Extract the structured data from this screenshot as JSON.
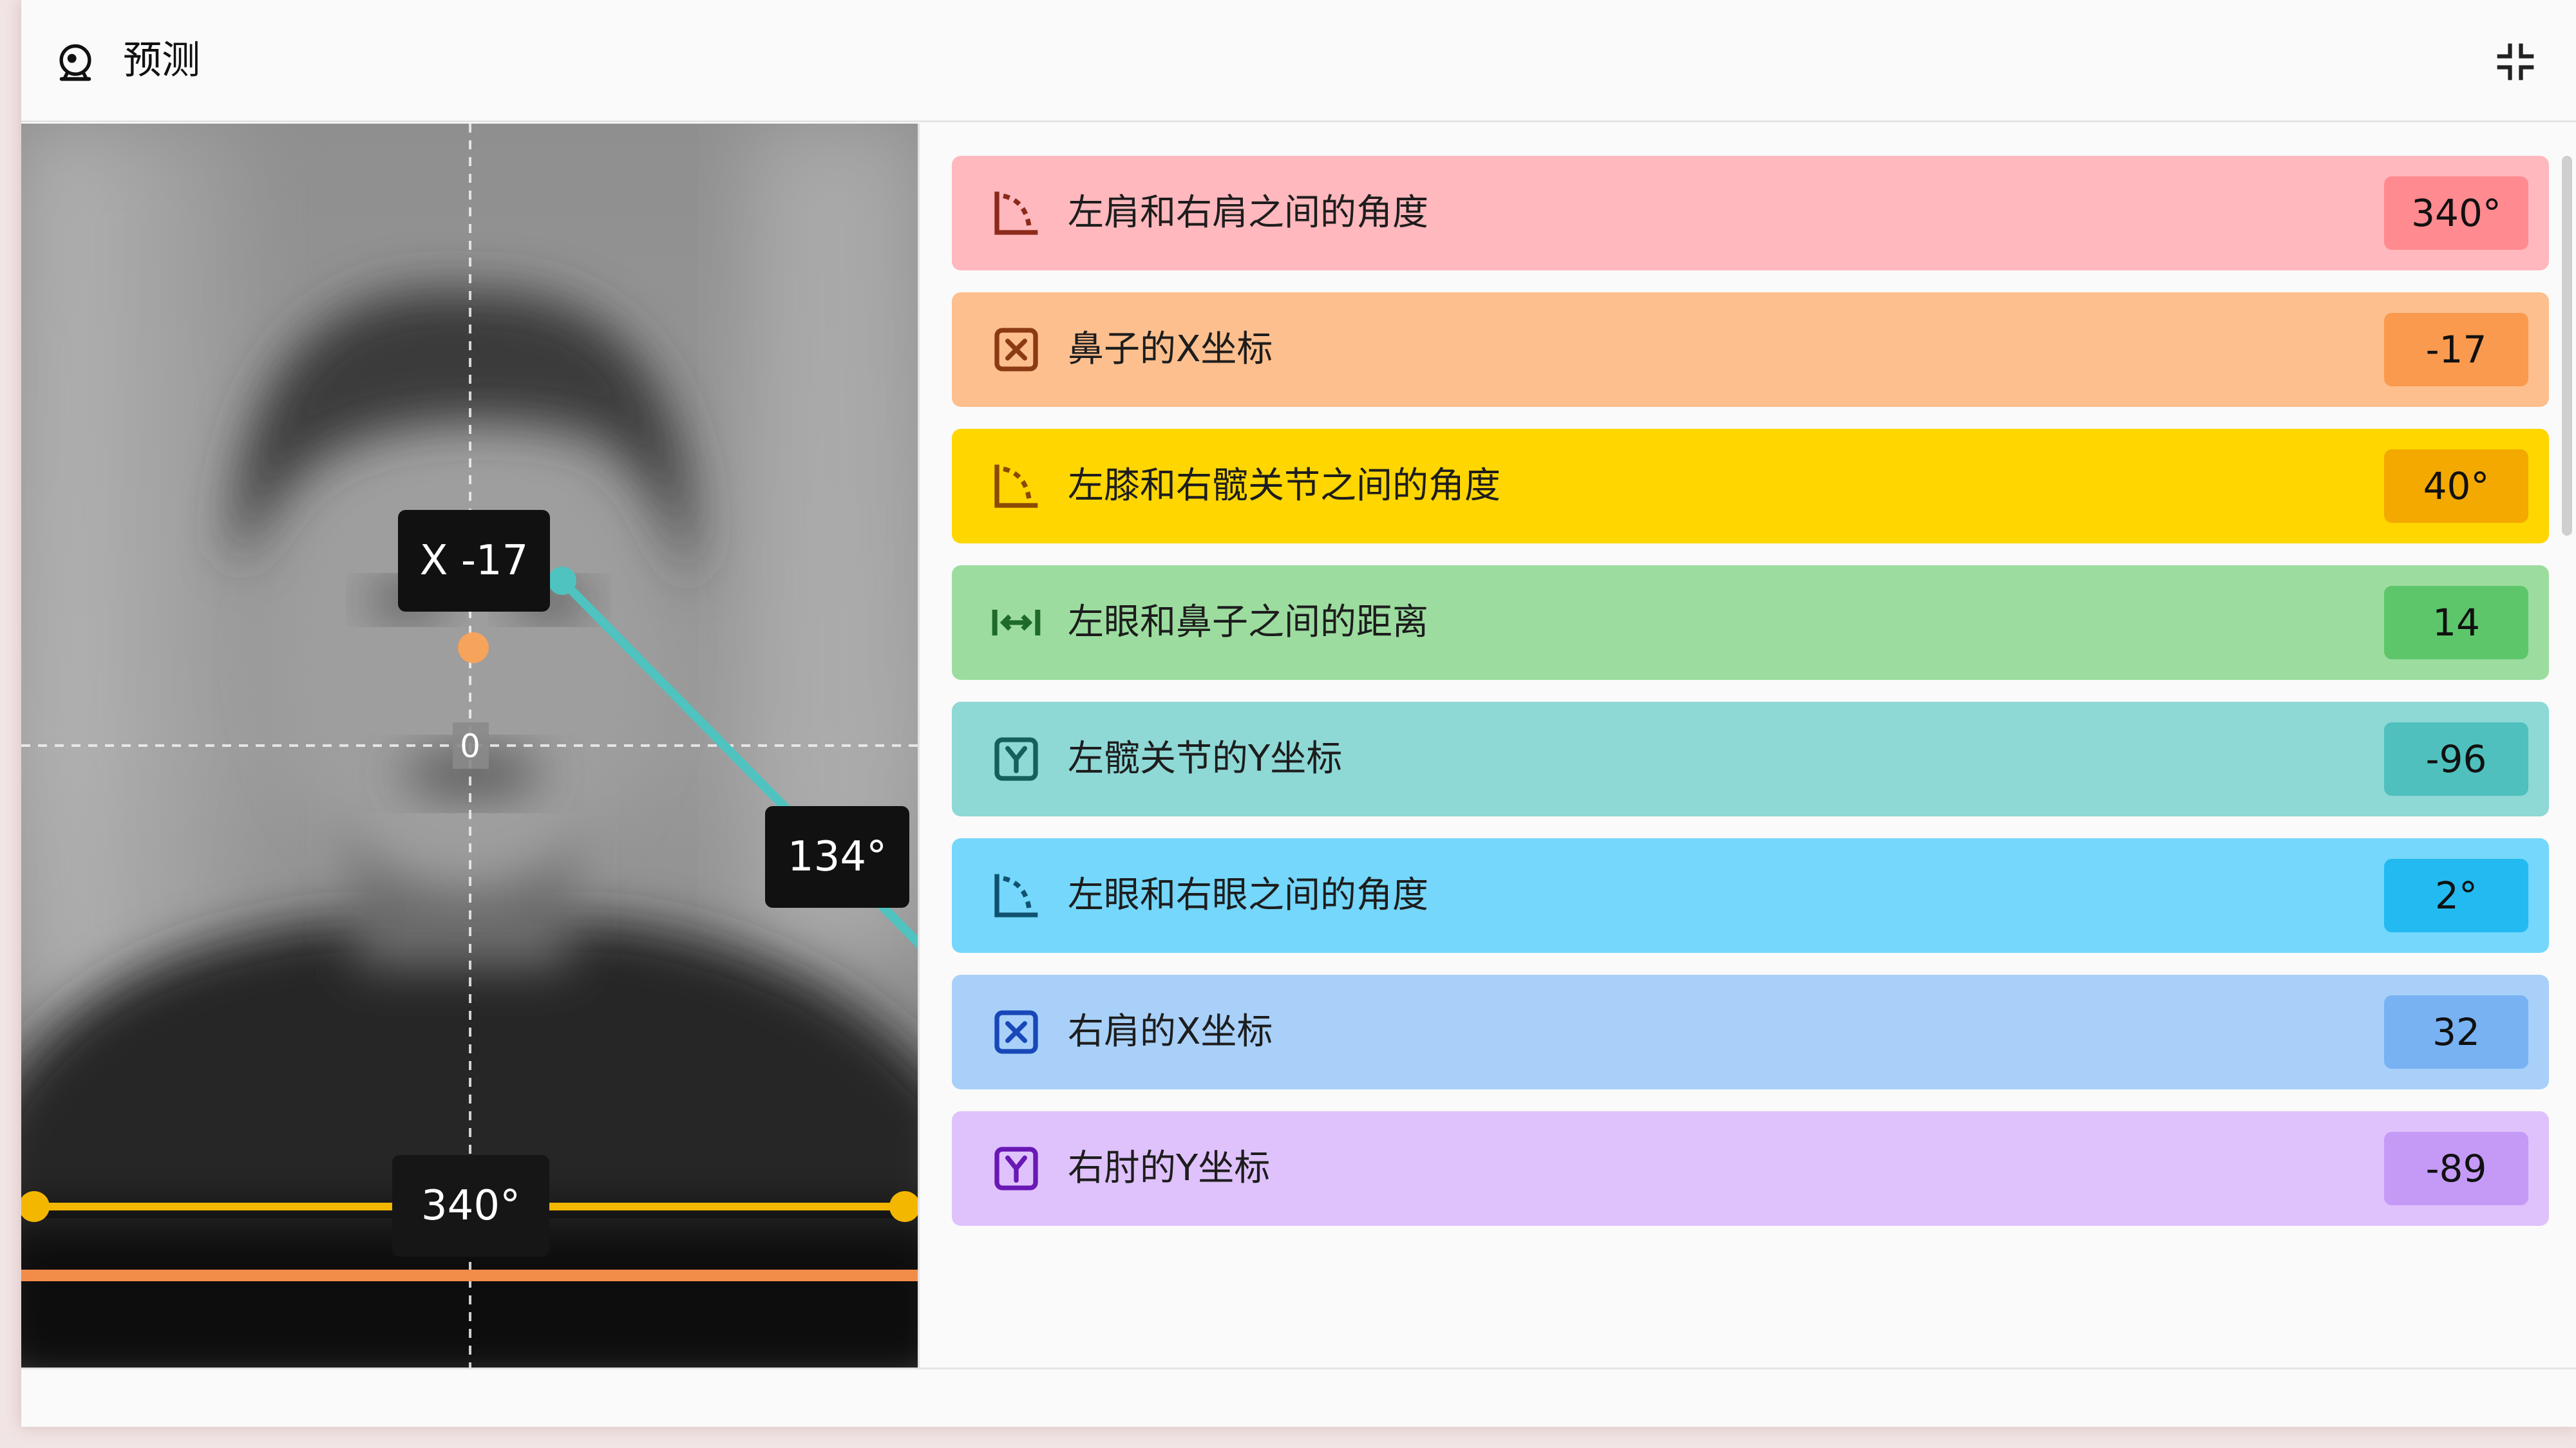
{
  "window": {
    "title": "预测",
    "title_icon": "robot-head-icon",
    "collapse_icon": "collapse-arrows-icon"
  },
  "camera": {
    "image": "blurred grayscale webcam view of a person",
    "axis_origin_label": "0",
    "nose_tag": "X -17",
    "elbow_angle_tag": "134°",
    "shoulder_angle_tag": "340°",
    "colors": {
      "teal_line": "#4fc3c0",
      "orange_point": "#f6a35b",
      "yellow_line": "#f3b700",
      "orange_line": "#f28c49"
    }
  },
  "items": [
    {
      "label": "左肩和右肩之间的角度",
      "value": "340°",
      "icon": "angle-icon",
      "bg": "#ffb8bd",
      "badge": "#ff8a8f",
      "icon_color": "#8b2a1a"
    },
    {
      "label": "鼻子的X坐标",
      "value": "-17",
      "icon": "x-box-icon",
      "bg": "#fdbf8e",
      "badge": "#f99a4e",
      "icon_color": "#8b3a13"
    },
    {
      "label": "左膝和右髋关节之间的角度",
      "value": "40°",
      "icon": "angle-icon",
      "bg": "#ffd600",
      "badge": "#f3a900",
      "icon_color": "#8b4a06"
    },
    {
      "label": "左眼和鼻子之间的距离",
      "value": "14",
      "icon": "distance-icon",
      "bg": "#9cdd9f",
      "badge": "#5ec66a",
      "icon_color": "#1e6a2a"
    },
    {
      "label": "左髋关节的Y坐标",
      "value": "-96",
      "icon": "y-box-icon",
      "bg": "#8ed8d6",
      "badge": "#4fc0bd",
      "icon_color": "#15605f"
    },
    {
      "label": "左眼和右眼之间的角度",
      "value": "2°",
      "icon": "angle-icon",
      "bg": "#74d7fb",
      "badge": "#22baf0",
      "icon_color": "#0f5270"
    },
    {
      "label": "右肩的X坐标",
      "value": "32",
      "icon": "x-box-icon",
      "bg": "#a8d0f9",
      "badge": "#78b2f3",
      "icon_color": "#1848b8"
    },
    {
      "label": "右肘的Y坐标",
      "value": "-89",
      "icon": "y-box-icon",
      "bg": "#dfc2fc",
      "badge": "#c59af7",
      "icon_color": "#6a18b5"
    }
  ]
}
